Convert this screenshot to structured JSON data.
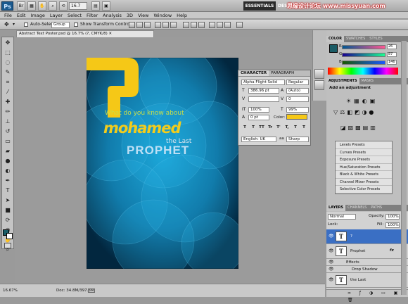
{
  "titlebar": {
    "logo": "Ps",
    "zoom": "16.7",
    "essentials": "ESSENTIALS",
    "design": "DES",
    "watermark": "思缘设计论坛 www.missyuan.com"
  },
  "menu": [
    "File",
    "Edit",
    "Image",
    "Layer",
    "Select",
    "Filter",
    "Analysis",
    "3D",
    "View",
    "Window",
    "Help"
  ],
  "options": {
    "auto_select": "Auto-Select:",
    "auto_select_value": "Group",
    "show_transform": "Show Transform Controls"
  },
  "document": {
    "tab_title": "Abstract Text Poster.psd @ 16.7% (?, CMYK/8) ✕",
    "zoom_status": "16.67%",
    "doc_size": "Doc: 34.8M/397.3M"
  },
  "poster": {
    "line1": "What do you know about",
    "name": "mohamed",
    "the_last": "the Last",
    "prophet": "PROPHET",
    "question_mark_color": "#f5c817"
  },
  "character_panel": {
    "tabs": [
      "CHARACTER",
      "PARAGRAPH"
    ],
    "font_family": "Alpha Flight Solid",
    "font_style": "Regular",
    "font_size": "386.96 pt",
    "leading": "(Auto)",
    "kerning": "",
    "tracking": "0",
    "vscale": "100%",
    "hscale": "99%",
    "baseline": "0 pt",
    "color_label": "Color:",
    "type_buttons": [
      "T",
      "T",
      "TT",
      "Tr",
      "T'",
      "T,",
      "T",
      "T"
    ],
    "language": "English: UK",
    "antialias": "Sharp",
    "antialias_prefix": "aa"
  },
  "color_panel": {
    "tabs": [
      "COLOR",
      "SWATCHES",
      "STYLES"
    ],
    "r": "26",
    "g": "87",
    "b": "146",
    "r_label": "R",
    "g_label": "G",
    "b_label": "B"
  },
  "adjustments": {
    "tabs": [
      "ADJUSTMENTS",
      "MASKS"
    ],
    "heading": "Add an adjustment",
    "presets": [
      "Levels Presets",
      "Curves Presets",
      "Exposure Presets",
      "Hue/Saturation Presets",
      "Black & White Presets",
      "Channel Mixer Presets",
      "Selective Color Presets"
    ]
  },
  "layers": {
    "tabs": [
      "LAYERS",
      "CHANNELS",
      "PATHS"
    ],
    "blend_mode": "Normal",
    "opacity_label": "Opacity:",
    "opacity": "100%",
    "fill_label": "Fill:",
    "fill": "100%",
    "lock_label": "Lock:",
    "rows": [
      {
        "name": "?",
        "fx": ""
      },
      {
        "name": "Prophet",
        "fx": "fx"
      },
      {
        "name": "Effects",
        "fx": ""
      },
      {
        "name": "Drop Shadow",
        "fx": ""
      },
      {
        "name": "the Last",
        "fx": ""
      }
    ],
    "thumb_glyph": "T"
  },
  "colors": {
    "accent_blue": "#3a6fc4",
    "yellow": "#f5c817",
    "canvas_bg": "#9b9b9b"
  }
}
